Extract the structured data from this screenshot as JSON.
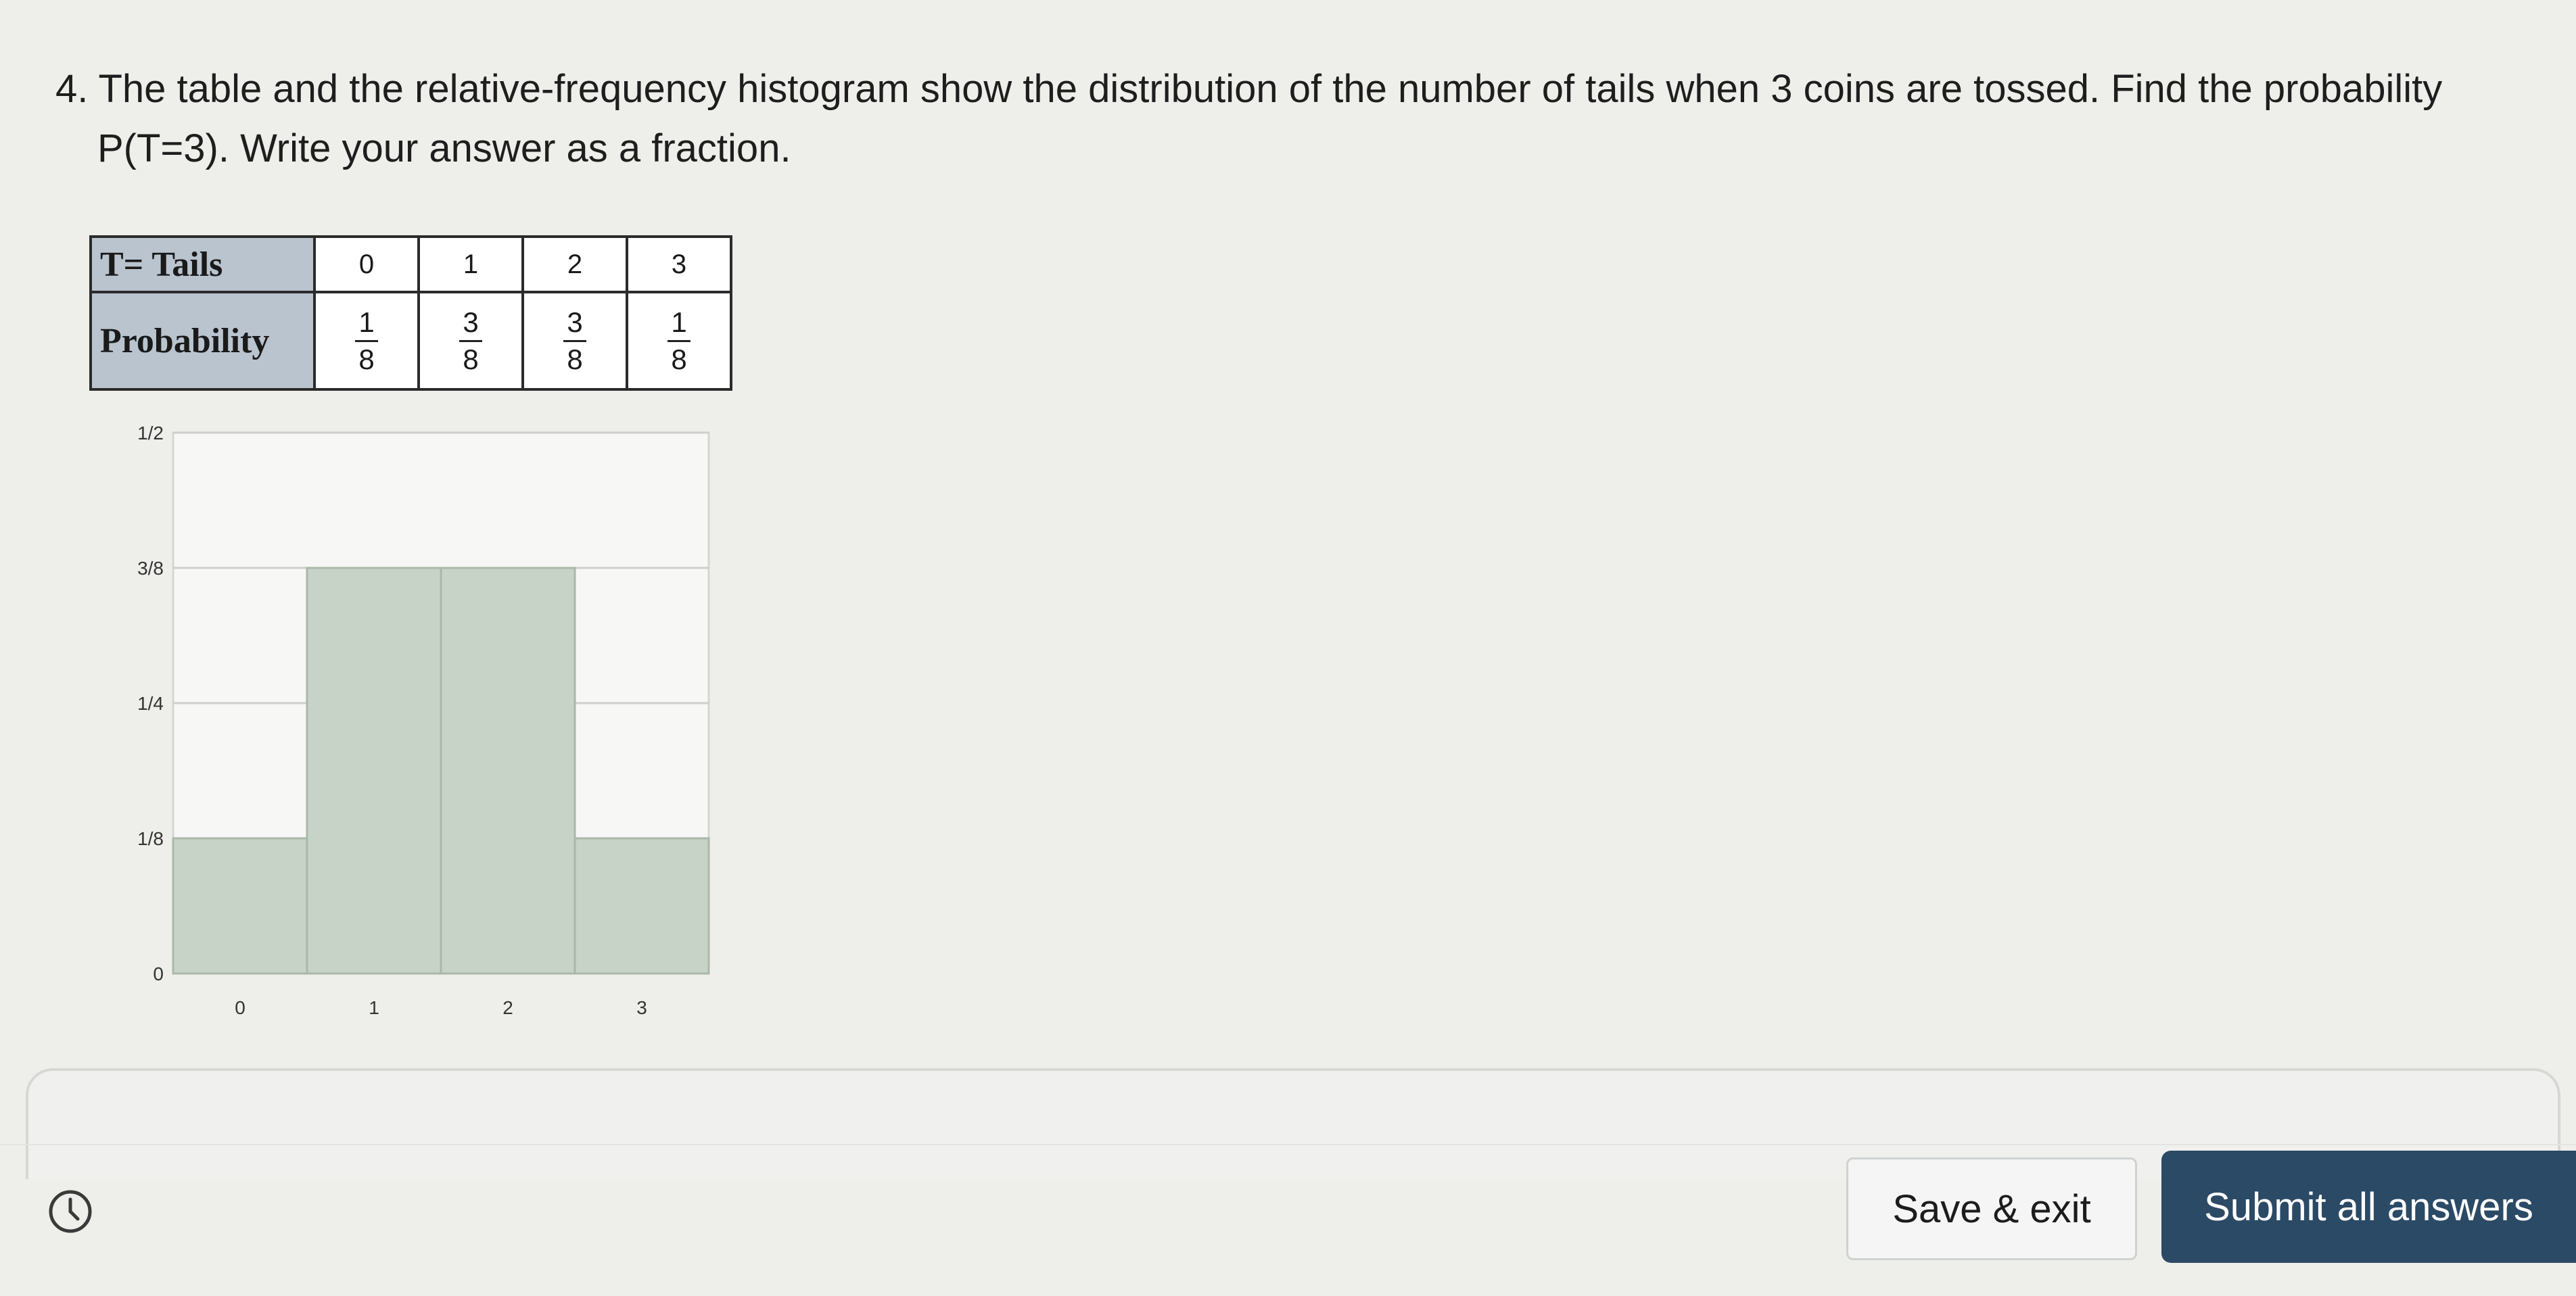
{
  "question": {
    "line1": "4. The table and the relative-frequency histogram show the distribution of the number of tails when 3 coins are tossed.  Find the probability",
    "line2": "P(T=3).  Write your answer as a fraction."
  },
  "table": {
    "row1_header": "T= Tails",
    "row2_header": "Probability",
    "t_values": [
      "0",
      "1",
      "2",
      "3"
    ],
    "probabilities": [
      {
        "num": "1",
        "den": "8"
      },
      {
        "num": "3",
        "den": "8"
      },
      {
        "num": "3",
        "den": "8"
      },
      {
        "num": "1",
        "den": "8"
      }
    ]
  },
  "chart_data": {
    "type": "bar",
    "categories": [
      "0",
      "1",
      "2",
      "3"
    ],
    "values": [
      0.125,
      0.375,
      0.375,
      0.125
    ],
    "ylim": [
      0,
      0.5
    ],
    "y_ticks": [
      {
        "value": 0,
        "label": "0"
      },
      {
        "value": 0.125,
        "label": "1/8"
      },
      {
        "value": 0.25,
        "label": "1/4"
      },
      {
        "value": 0.375,
        "label": "3/8"
      },
      {
        "value": 0.5,
        "label": "1/2"
      }
    ],
    "title": "",
    "xlabel": "",
    "ylabel": "",
    "grid": true,
    "bar_color": "#c6d3c6",
    "bar_edge_color": "#a9b8a9"
  },
  "footer": {
    "clock_icon": "clock-icon",
    "save_label": "Save & exit",
    "submit_label": "Submit all answers"
  },
  "colors": {
    "background": "#eeeeeb",
    "table_header": "#b9c4cf",
    "submit_button": "#2b4a66"
  }
}
